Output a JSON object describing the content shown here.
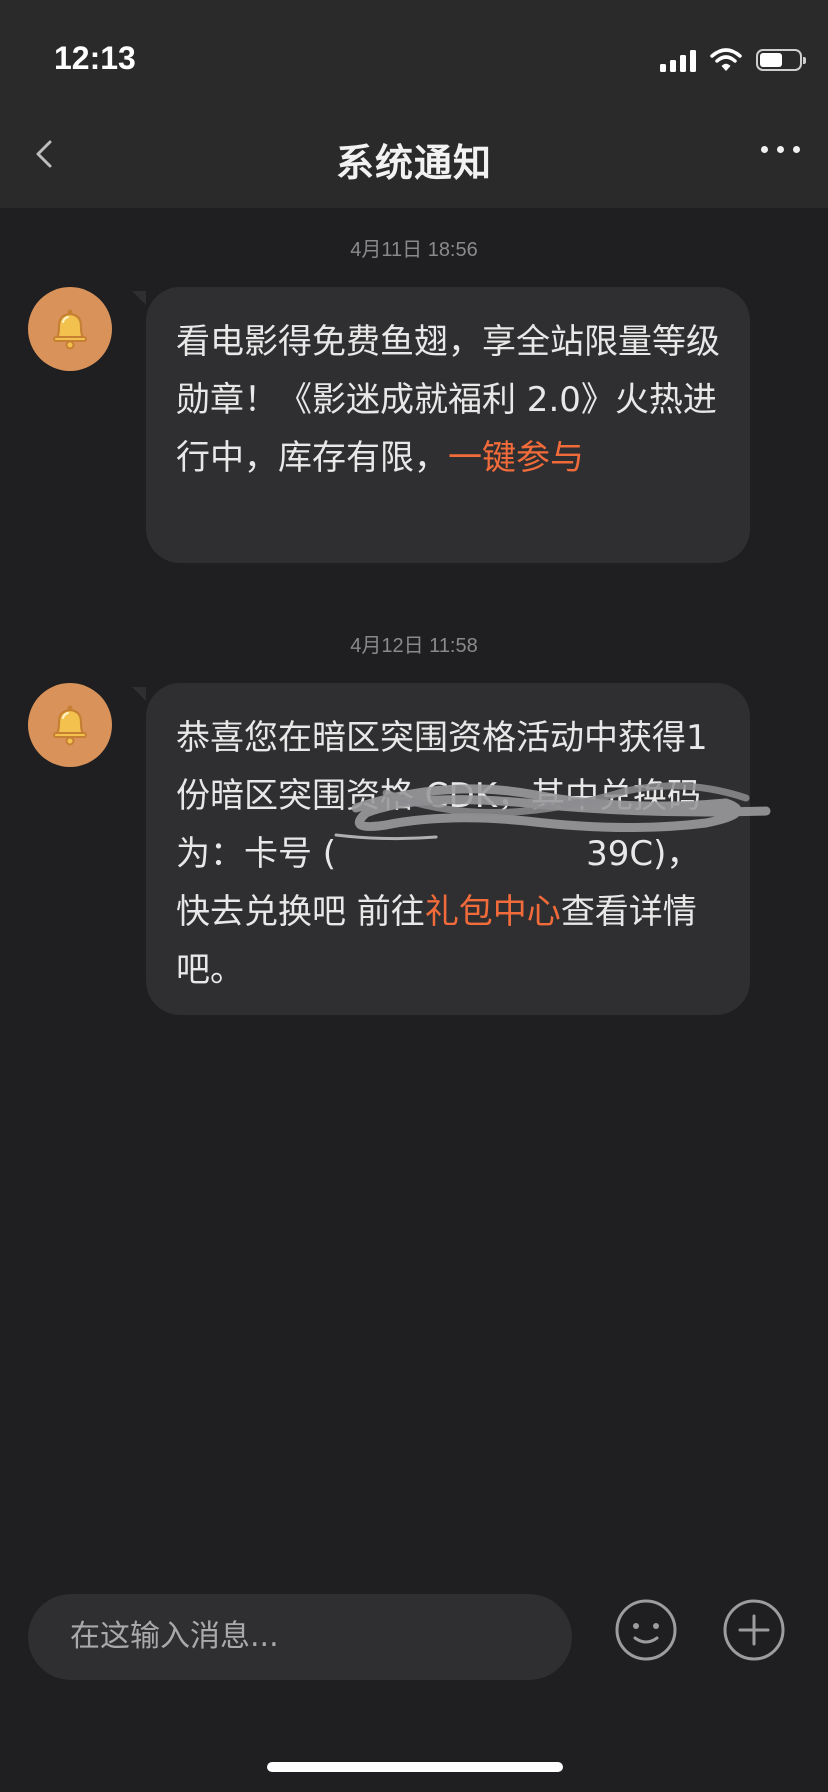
{
  "status_bar": {
    "time": "12:13",
    "battery_level": 0.6
  },
  "nav": {
    "title": "系统通知"
  },
  "messages": [
    {
      "timestamp": "4月11日 18:56",
      "parts": [
        {
          "text": "看电影得免费鱼翅，享全站限量等级勋章！《影迷成就福利 2.0》火热进行中，库存有限，",
          "link": false
        },
        {
          "text": "一键参与",
          "link": true
        }
      ]
    },
    {
      "timestamp": "4月12日 11:58",
      "parts": [
        {
          "text": "恭喜您在暗区突围资格活动中获得1份暗区突围资格 CDK，其中兑换码为：卡号 (",
          "link": false
        },
        {
          "text": "39C)，快去兑换吧 前往",
          "link": false
        },
        {
          "text": "礼包中心",
          "link": true
        },
        {
          "text": "查看详情吧。",
          "link": false
        }
      ]
    }
  ],
  "input": {
    "placeholder": "在这输入消息..."
  },
  "colors": {
    "background": "#1f1f21",
    "header": "#2a2a2b",
    "bubble": "#2f2f31",
    "link": "#f26b3a",
    "avatar": "#d9935a"
  },
  "icons": {
    "back": "chevron-left-icon",
    "more": "more-dots-icon",
    "avatar": "bell-icon",
    "emoji": "emoji-icon",
    "add": "plus-circle-icon"
  }
}
